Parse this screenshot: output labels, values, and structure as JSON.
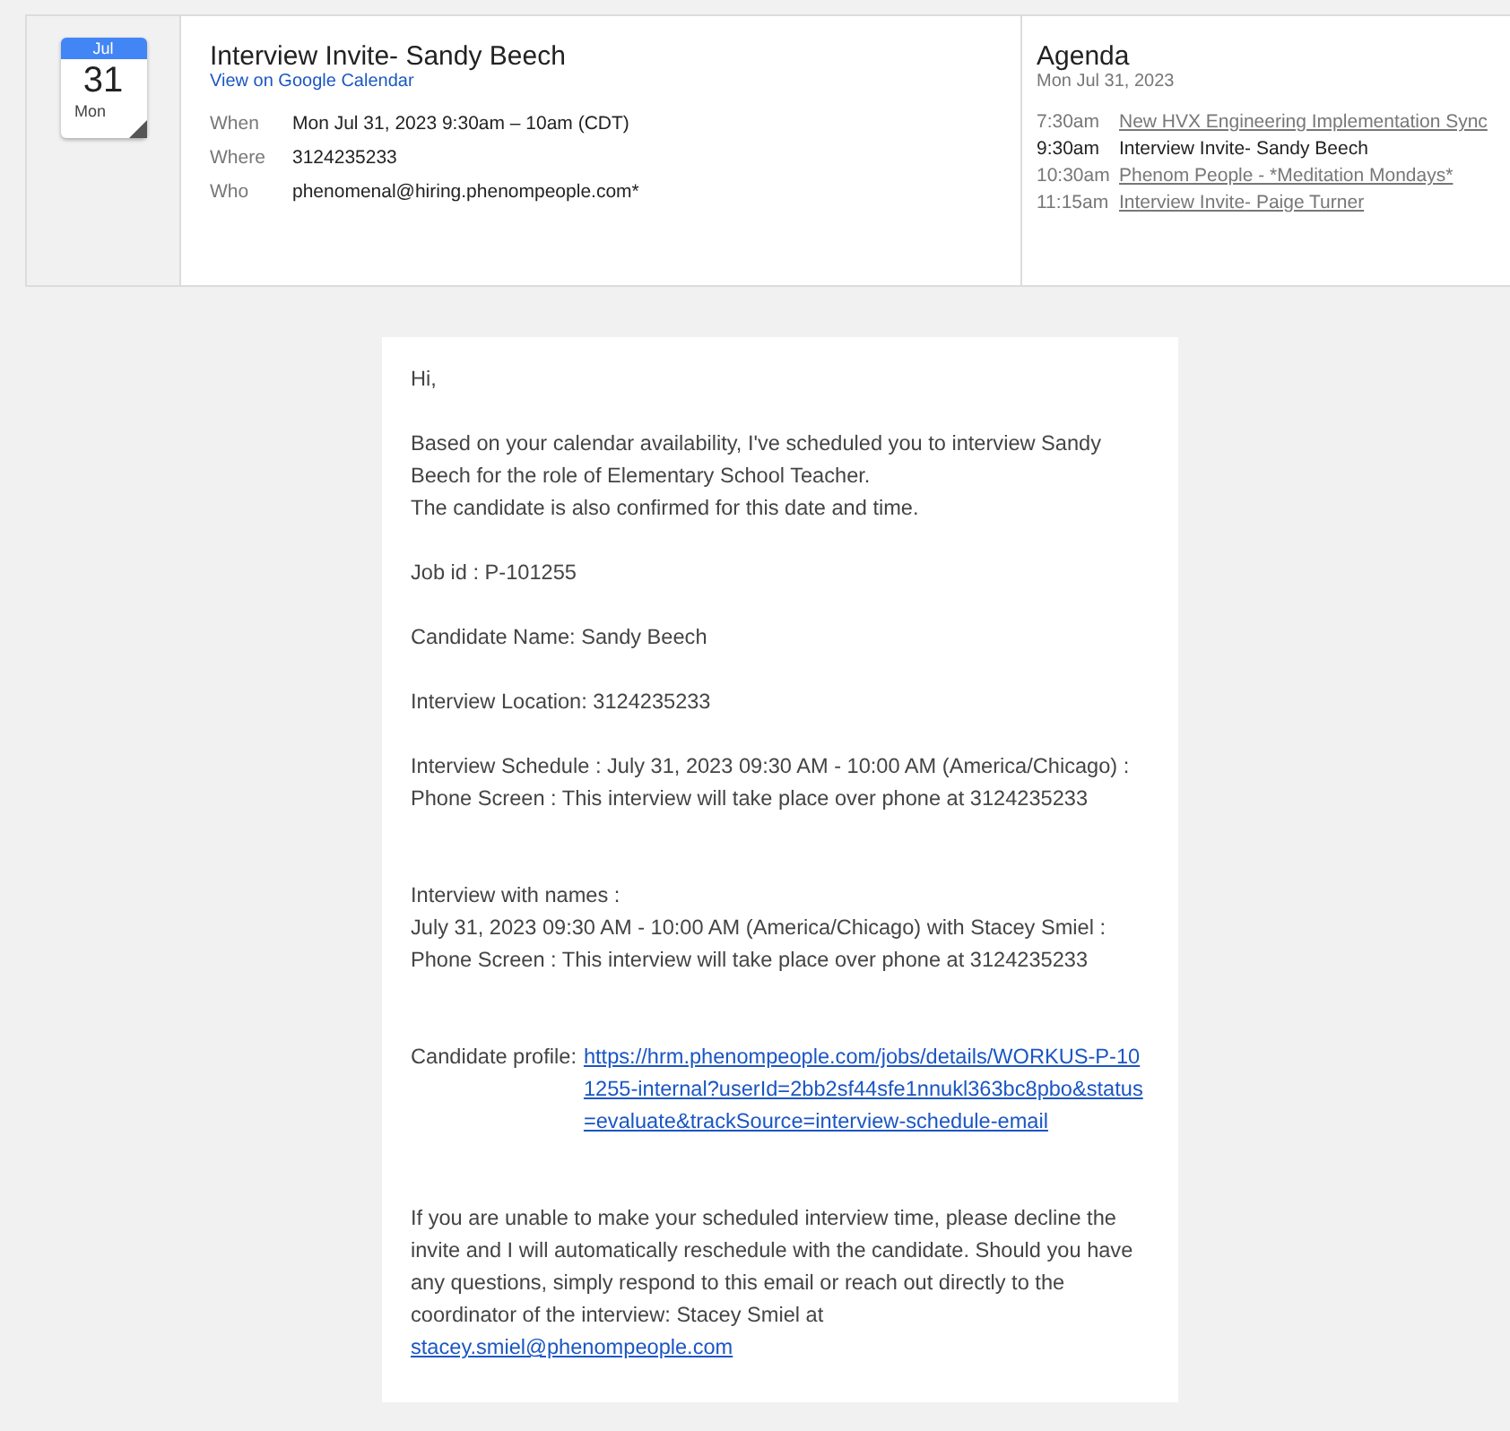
{
  "event": {
    "calendar_icon": {
      "month": "Jul",
      "day": "31",
      "weekday": "Mon"
    },
    "title": "Interview Invite- Sandy Beech",
    "calendar_link": "View on Google Calendar",
    "details": [
      {
        "label": "When",
        "value": "Mon Jul 31, 2023 9:30am – 10am (CDT)"
      },
      {
        "label": "Where",
        "value": "3124235233"
      },
      {
        "label": "Who",
        "value": "phenomenal@hiring.phenompeople.com*"
      }
    ]
  },
  "agenda": {
    "title": "Agenda",
    "date": "Mon Jul 31, 2023",
    "items": [
      {
        "time": "7:30am",
        "title": "New HVX Engineering Implementation Sync",
        "selected": false
      },
      {
        "time": "9:30am",
        "title": "Interview Invite- Sandy Beech",
        "selected": true
      },
      {
        "time": "10:30am",
        "title": "Phenom People - *Meditation Mondays*",
        "selected": false
      },
      {
        "time": "11:15am",
        "title": "Interview Invite- Paige Turner",
        "selected": false
      }
    ]
  },
  "email": {
    "paragraphs": [
      {
        "kind": "text",
        "lines": [
          "Hi,"
        ]
      },
      {
        "kind": "text",
        "lines": [
          "Based on your calendar availability, I've scheduled you to interview Sandy Beech for the role of Elementary School Teacher.",
          "The candidate is also confirmed for this date and time."
        ]
      },
      {
        "kind": "text",
        "lines": [
          "Job id : P-101255"
        ]
      },
      {
        "kind": "text",
        "lines": [
          "Candidate Name: Sandy Beech"
        ]
      },
      {
        "kind": "text",
        "lines": [
          "Interview Location: 3124235233"
        ]
      },
      {
        "kind": "text",
        "lines": [
          "Interview Schedule :  July 31, 2023 09:30 AM - 10:00 AM (America/Chicago) : Phone Screen : This interview will take place over phone at 3124235233"
        ]
      },
      {
        "kind": "text",
        "lines": [
          "Interview with names :",
          "July 31, 2023 09:30 AM - 10:00 AM (America/Chicago) with Stacey Smiel : Phone Screen : This interview will take place over phone at 3124235233"
        ]
      },
      {
        "kind": "link",
        "text": "Candidate profile:",
        "link": "https://hrm.phenompeople.com/jobs/details/WORKUS-P-101255-internal?userId=2bb2sf44sfe1nnukl363bc8pbo&status=evaluate&trackSource=interview-schedule-email"
      },
      {
        "kind": "link",
        "text": "If you are unable to make your scheduled interview time, please decline the invite and I will automatically reschedule with the candidate. Should you have any questions, simply respond to this email or reach out directly to the coordinator of the interview: Stacey Smiel at",
        "link": "stacey.smiel@phenompeople.com"
      }
    ]
  }
}
